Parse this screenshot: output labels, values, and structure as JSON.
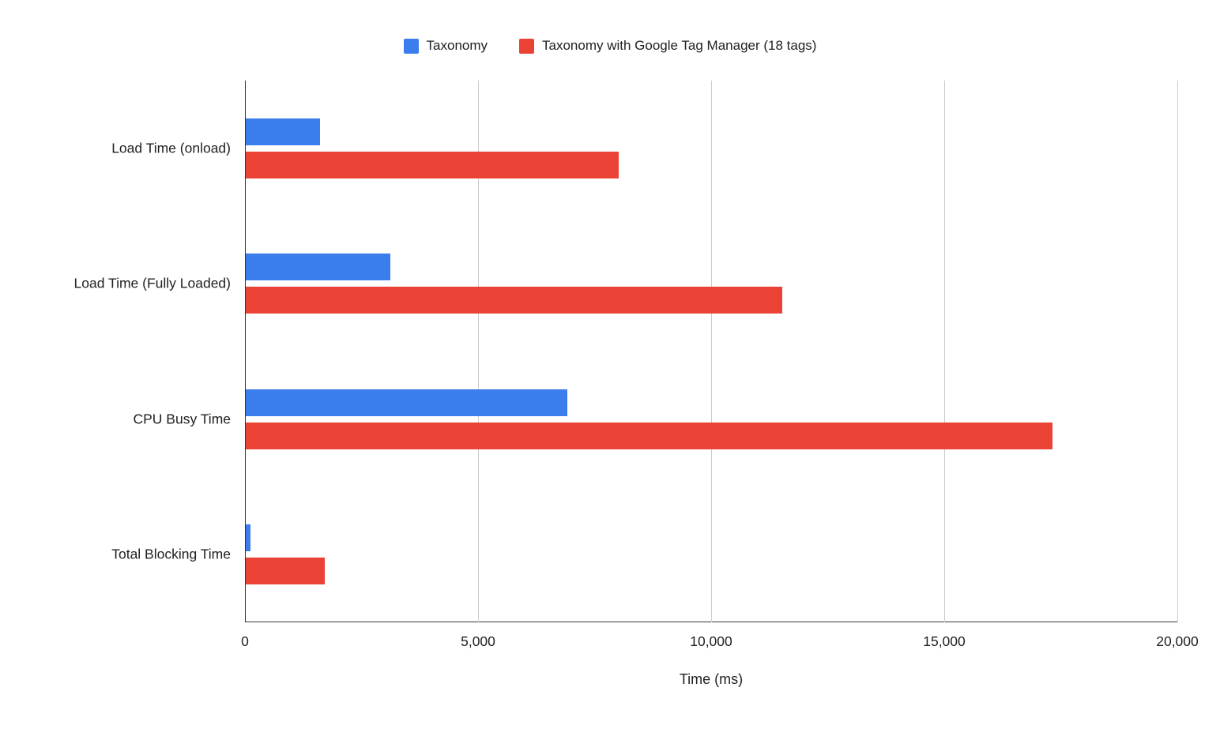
{
  "chart_data": {
    "type": "bar",
    "orientation": "horizontal",
    "title": "",
    "xlabel": "Time (ms)",
    "ylabel": "",
    "categories": [
      "Load Time (onload)",
      "Load Time (Fully Loaded)",
      "CPU Busy Time",
      "Total Blocking Time"
    ],
    "series": [
      {
        "name": "Taxonomy",
        "color": "#3b7ded",
        "values": [
          1600,
          3100,
          6900,
          100
        ]
      },
      {
        "name": "Taxonomy with Google Tag Manager (18 tags)",
        "color": "#ea4235",
        "values": [
          8000,
          11500,
          17300,
          1700
        ]
      }
    ],
    "xlim": [
      0,
      20000
    ],
    "x_ticks": [
      0,
      5000,
      10000,
      15000,
      20000
    ],
    "x_tick_labels": [
      "0",
      "5,000",
      "10,000",
      "15,000",
      "20,000"
    ],
    "grid": true,
    "legend_position": "top"
  }
}
